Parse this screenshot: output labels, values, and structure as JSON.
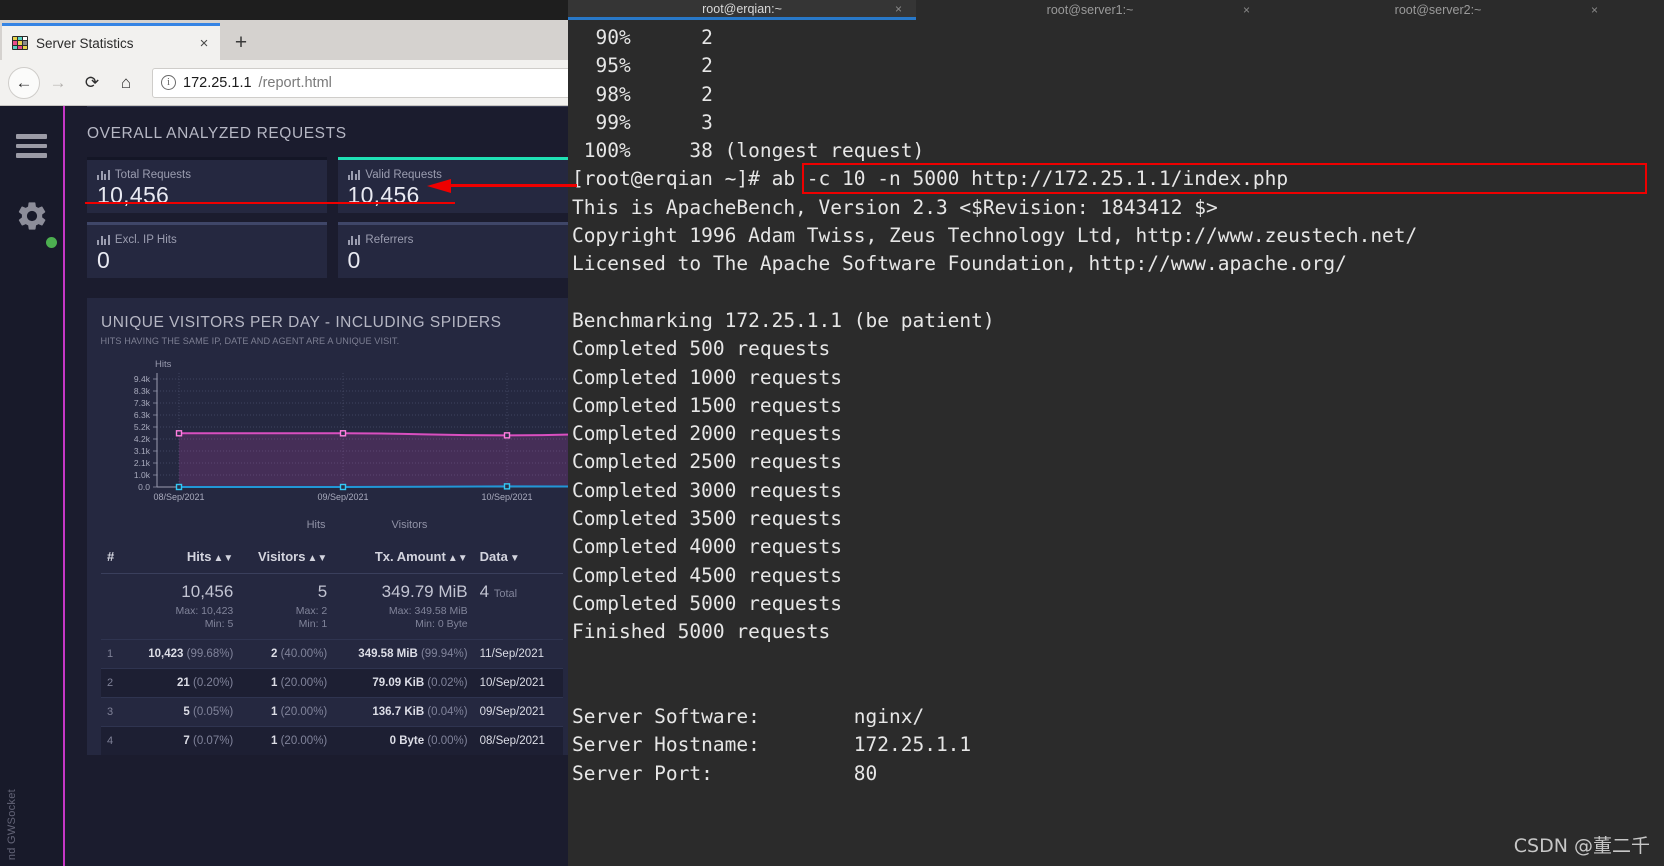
{
  "browser": {
    "tab": {
      "title": "Server Statistics",
      "close_label": "×",
      "favicon": "chart-favicon"
    },
    "newtab_label": "+",
    "nav": {
      "back": "←",
      "forward": "→",
      "reload": "⟳",
      "home": "⌂"
    },
    "url": {
      "info_icon": "ⓘ",
      "host": "172.25.1.1",
      "path": "/report.html"
    }
  },
  "goaccess": {
    "sidebar": {
      "menu_icon": "hamburger-icon",
      "settings_icon": "gear-icon",
      "status": "online",
      "vertical_note": "nd GWSocket"
    },
    "overall": {
      "title": "OVERALL ANALYZED REQUESTS",
      "cards": [
        {
          "label": "Total Requests",
          "value": "10,456",
          "accent": "#141626"
        },
        {
          "label": "Valid Requests",
          "value": "10,456",
          "accent": "#1fe0b5"
        },
        {
          "label": "Excl. IP Hits",
          "value": "0",
          "accent": "#3f4668"
        },
        {
          "label": "Referrers",
          "value": "0",
          "accent": "#3f4668"
        }
      ]
    },
    "visitors_panel": {
      "title": "UNIQUE VISITORS PER DAY - INCLUDING SPIDERS",
      "subtitle": "HITS HAVING THE SAME IP, DATE AND AGENT ARE A UNIQUE VISIT.",
      "table": {
        "headers": [
          "#",
          "Hits",
          "Visitors",
          "Tx. Amount",
          "Data"
        ],
        "summary": {
          "hits": "10,456",
          "hits_max": "Max: 10,423",
          "hits_min": "Min: 5",
          "visitors": "5",
          "visitors_max": "Max: 2",
          "visitors_min": "Min: 1",
          "tx": "349.79 MiB",
          "tx_max": "Max: 349.58 MiB",
          "tx_min": "Min: 0 Byte",
          "data_count": "4",
          "data_total_label": "Total"
        },
        "rows": [
          {
            "idx": "1",
            "hits": "10,423",
            "hits_pct": "(99.68%)",
            "visitors": "2",
            "visitors_pct": "(40.00%)",
            "tx": "349.58 MiB",
            "tx_pct": "(99.94%)",
            "date": "11/Sep/2021"
          },
          {
            "idx": "2",
            "hits": "21",
            "hits_pct": "(0.20%)",
            "visitors": "1",
            "visitors_pct": "(20.00%)",
            "tx": "79.09 KiB",
            "tx_pct": "(0.02%)",
            "date": "10/Sep/2021"
          },
          {
            "idx": "3",
            "hits": "5",
            "hits_pct": "(0.05%)",
            "visitors": "1",
            "visitors_pct": "(20.00%)",
            "tx": "136.7 KiB",
            "tx_pct": "(0.04%)",
            "date": "09/Sep/2021"
          },
          {
            "idx": "4",
            "hits": "7",
            "hits_pct": "(0.07%)",
            "visitors": "1",
            "visitors_pct": "(20.00%)",
            "tx": "0 Byte",
            "tx_pct": "(0.00%)",
            "date": "08/Sep/2021"
          }
        ]
      }
    }
  },
  "chart_data": {
    "type": "line",
    "title": "UNIQUE VISITORS PER DAY - INCLUDING SPIDERS",
    "subtitle": "HITS HAVING THE SAME IP, DATE AND AGENT ARE A UNIQUE VISIT.",
    "ylabel": "Hits",
    "xlabel": "",
    "categories": [
      "08/Sep/2021",
      "09/Sep/2021",
      "10/Sep/2021",
      "11/Sep/2021"
    ],
    "visible_categories": [
      "08/Sep/2021",
      "09/Sep/2021",
      "10/Sep/2021"
    ],
    "ytick_labels": [
      "0.0",
      "1.0k",
      "2.1k",
      "3.1k",
      "4.2k",
      "5.2k",
      "6.3k",
      "7.3k",
      "8.3k",
      "9.4k"
    ],
    "ylim": [
      0,
      10456
    ],
    "grid": true,
    "legend_position": "bottom",
    "series": [
      {
        "name": "Hits",
        "color": "#d94fc0",
        "values": [
          5200,
          5200,
          5000,
          5250
        ]
      },
      {
        "name": "Visitors",
        "color": "#2196d6",
        "values": [
          0,
          0,
          60,
          40
        ]
      }
    ]
  },
  "terminal": {
    "tabs": [
      {
        "title": "root@erqian:~",
        "active": true,
        "close": "×"
      },
      {
        "title": "root@server1:~",
        "active": false,
        "close": "×"
      },
      {
        "title": "root@server2:~",
        "active": false,
        "close": "×"
      }
    ],
    "lines": [
      "  90%      2",
      "  95%      2",
      "  98%      2",
      "  99%      3",
      " 100%     38 (longest request)",
      "[root@erqian ~]# ab -c 10 -n 5000 http://172.25.1.1/index.php",
      "This is ApacheBench, Version 2.3 <$Revision: 1843412 $>",
      "Copyright 1996 Adam Twiss, Zeus Technology Ltd, http://www.zeustech.net/",
      "Licensed to The Apache Software Foundation, http://www.apache.org/",
      "",
      "Benchmarking 172.25.1.1 (be patient)",
      "Completed 500 requests",
      "Completed 1000 requests",
      "Completed 1500 requests",
      "Completed 2000 requests",
      "Completed 2500 requests",
      "Completed 3000 requests",
      "Completed 3500 requests",
      "Completed 4000 requests",
      "Completed 4500 requests",
      "Completed 5000 requests",
      "Finished 5000 requests",
      "",
      "",
      "Server Software:        nginx/",
      "Server Hostname:        172.25.1.1",
      "Server Port:            80"
    ],
    "command": "ab -c 10 -n 5000 http://172.25.1.1/index.php",
    "prompt": "[root@erqian ~]#"
  },
  "watermark": "CSDN @董二千",
  "annotations": {
    "highlight_color": "#ee0000",
    "box_target": "ab command",
    "arrow_target": "Valid Requests value"
  }
}
